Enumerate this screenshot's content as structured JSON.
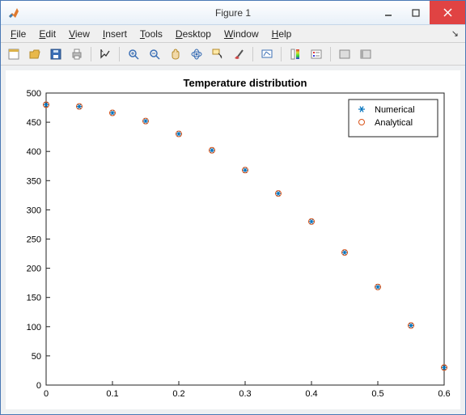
{
  "window": {
    "title": "Figure 1"
  },
  "menu": {
    "items": [
      {
        "label": "File",
        "ul": "F"
      },
      {
        "label": "Edit",
        "ul": "E"
      },
      {
        "label": "View",
        "ul": "V"
      },
      {
        "label": "Insert",
        "ul": "I"
      },
      {
        "label": "Tools",
        "ul": "T"
      },
      {
        "label": "Desktop",
        "ul": "D"
      },
      {
        "label": "Window",
        "ul": "W"
      },
      {
        "label": "Help",
        "ul": "H"
      }
    ]
  },
  "toolbar": {
    "buttons": [
      "new-figure",
      "open",
      "save",
      "print",
      "sep",
      "edit-plot",
      "sep",
      "zoom-in",
      "zoom-out",
      "pan",
      "rotate-3d",
      "data-cursor",
      "brush",
      "sep",
      "link-plot",
      "sep",
      "insert-colorbar",
      "insert-legend",
      "sep",
      "hide-tools",
      "show-tools"
    ]
  },
  "chart_data": {
    "type": "scatter",
    "title": "Temperature distribution",
    "xlabel": "",
    "ylabel": "",
    "xlim": [
      0,
      0.6
    ],
    "ylim": [
      0,
      500
    ],
    "xticks": [
      0,
      0.1,
      0.2,
      0.3,
      0.4,
      0.5,
      0.6
    ],
    "yticks": [
      0,
      50,
      100,
      150,
      200,
      250,
      300,
      350,
      400,
      450,
      500
    ],
    "series": [
      {
        "name": "Numerical",
        "marker": "star",
        "color": "#0072bd",
        "x": [
          0,
          0.05,
          0.1,
          0.15,
          0.2,
          0.25,
          0.3,
          0.35,
          0.4,
          0.45,
          0.5,
          0.55,
          0.6
        ],
        "y": [
          480,
          477,
          466,
          452,
          430,
          402,
          368,
          328,
          280,
          227,
          168,
          102,
          30
        ]
      },
      {
        "name": "Analytical",
        "marker": "circle",
        "color": "#d95319",
        "x": [
          0,
          0.05,
          0.1,
          0.15,
          0.2,
          0.25,
          0.3,
          0.35,
          0.4,
          0.45,
          0.5,
          0.55,
          0.6
        ],
        "y": [
          480,
          477,
          466,
          452,
          430,
          402,
          368,
          328,
          280,
          227,
          168,
          102,
          30
        ]
      }
    ],
    "legend": {
      "position": "northeast"
    }
  }
}
